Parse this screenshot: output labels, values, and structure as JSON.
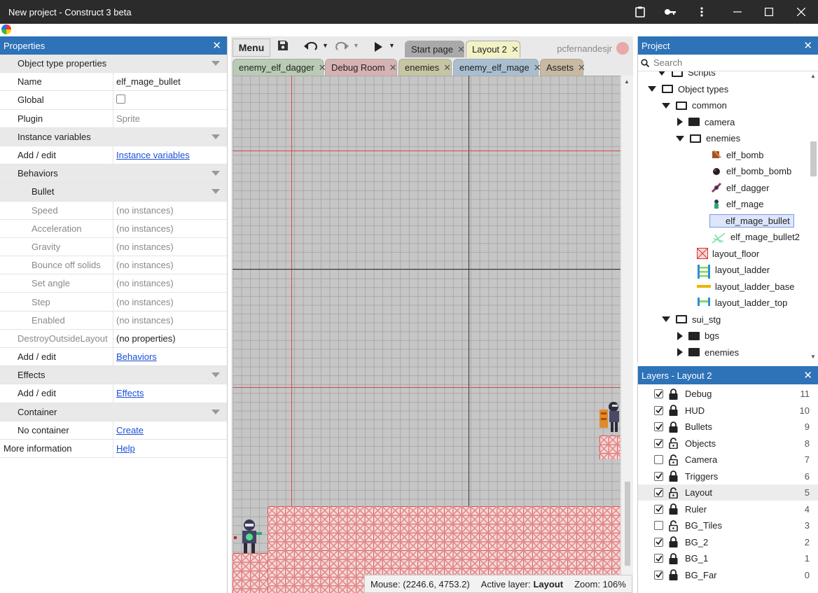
{
  "window": {
    "title": "New project - Construct 3 beta",
    "controls": [
      "clipboard-icon",
      "key-icon",
      "more-icon",
      "minimize-icon",
      "maximize-icon",
      "close-icon"
    ]
  },
  "properties": {
    "title": "Properties",
    "rows": [
      {
        "type": "section",
        "label": "Object type properties"
      },
      {
        "type": "row",
        "label": "Name",
        "value": "elf_mage_bullet"
      },
      {
        "type": "row",
        "label": "Global",
        "value": ""
      },
      {
        "type": "row",
        "label": "Plugin",
        "value": "Sprite",
        "dim": true
      },
      {
        "type": "section",
        "label": "Instance variables"
      },
      {
        "type": "row",
        "label": "Add / edit",
        "value": "Instance variables",
        "link": true
      },
      {
        "type": "section",
        "label": "Behaviors"
      },
      {
        "type": "subsection",
        "label": "Bullet"
      },
      {
        "type": "sub",
        "label": "Speed",
        "value": "(no instances)"
      },
      {
        "type": "sub",
        "label": "Acceleration",
        "value": "(no instances)"
      },
      {
        "type": "sub",
        "label": "Gravity",
        "value": "(no instances)"
      },
      {
        "type": "sub",
        "label": "Bounce off solids",
        "value": "(no instances)"
      },
      {
        "type": "sub",
        "label": "Set angle",
        "value": "(no instances)"
      },
      {
        "type": "sub",
        "label": "Step",
        "value": "(no instances)"
      },
      {
        "type": "sub",
        "label": "Enabled",
        "value": "(no instances)"
      },
      {
        "type": "rowgray",
        "label": "DestroyOutsideLayout",
        "value": "(no properties)"
      },
      {
        "type": "row",
        "label": "Add / edit",
        "value": "Behaviors",
        "link": true
      },
      {
        "type": "section",
        "label": "Effects"
      },
      {
        "type": "row",
        "label": "Add / edit",
        "value": "Effects",
        "link": true
      },
      {
        "type": "section",
        "label": "Container"
      },
      {
        "type": "row",
        "label": "No container",
        "value": "Create",
        "link": true
      },
      {
        "type": "lvl0",
        "label": "More information",
        "value": "Help",
        "link": true
      }
    ]
  },
  "editor": {
    "menu_label": "Menu",
    "tabs_row1": [
      {
        "label": "Start page",
        "color": "#a9a9a9"
      },
      {
        "label": "Layout 2",
        "color": "#f2f2c4"
      }
    ],
    "tabs_row2": [
      {
        "label": "enemy_elf_dagger",
        "color": "#b9cbb4"
      },
      {
        "label": "Debug Room",
        "color": "#d7b2b2"
      },
      {
        "label": "enemies",
        "color": "#c6c6a2"
      },
      {
        "label": "enemy_elf_mage",
        "color": "#a9bfd0"
      },
      {
        "label": "Assets",
        "color": "#c9b9a1"
      }
    ],
    "user": "pcfernandesjr",
    "status": {
      "mouse": "Mouse: (2246.6, 4753.2)",
      "layer_label": "Active layer:",
      "layer_value": "Layout",
      "zoom": "Zoom: 106%"
    }
  },
  "project": {
    "title": "Project",
    "search_placeholder": "Search",
    "tree": [
      {
        "label": "Scripts",
        "icon": "folder"
      },
      {
        "label": "Object types",
        "icon": "folder"
      },
      {
        "label": "common",
        "icon": "folder"
      },
      {
        "label": "camera",
        "icon": "folder-filled"
      },
      {
        "label": "enemies",
        "icon": "folder"
      },
      {
        "label": "elf_bomb",
        "icon": "sprite-bomb-icon"
      },
      {
        "label": "elf_bomb_bomb",
        "icon": "sprite-ball-icon"
      },
      {
        "label": "elf_dagger",
        "icon": "sprite-dagger-icon"
      },
      {
        "label": "elf_mage",
        "icon": "sprite-mage-icon"
      },
      {
        "label": "elf_mage_bullet",
        "icon": "sprite-bullet-icon",
        "selected": true
      },
      {
        "label": "elf_mage_bullet2",
        "icon": "sprite-bullet2-icon"
      },
      {
        "label": "layout_floor",
        "icon": "tile-floor-icon"
      },
      {
        "label": "layout_ladder",
        "icon": "tile-ladder-icon"
      },
      {
        "label": "layout_ladder_base",
        "icon": "tile-ladder-base-icon"
      },
      {
        "label": "layout_ladder_top",
        "icon": "tile-ladder-top-icon"
      },
      {
        "label": "sui_stg",
        "icon": "folder"
      },
      {
        "label": "bgs",
        "icon": "folder-filled"
      },
      {
        "label": "enemies",
        "icon": "folder-filled"
      }
    ]
  },
  "layers": {
    "title": "Layers - Layout 2",
    "items": [
      {
        "name": "Debug",
        "index": "11",
        "visible": true,
        "locked": true
      },
      {
        "name": "HUD",
        "index": "10",
        "visible": true,
        "locked": true
      },
      {
        "name": "Bullets",
        "index": "9",
        "visible": true,
        "locked": true
      },
      {
        "name": "Objects",
        "index": "8",
        "visible": true,
        "locked": false
      },
      {
        "name": "Camera",
        "index": "7",
        "visible": false,
        "locked": false
      },
      {
        "name": "Triggers",
        "index": "6",
        "visible": true,
        "locked": true
      },
      {
        "name": "Layout",
        "index": "5",
        "visible": true,
        "locked": false,
        "active": true
      },
      {
        "name": "Ruler",
        "index": "4",
        "visible": true,
        "locked": true
      },
      {
        "name": "BG_Tiles",
        "index": "3",
        "visible": false,
        "locked": false
      },
      {
        "name": "BG_2",
        "index": "2",
        "visible": true,
        "locked": true
      },
      {
        "name": "BG_1",
        "index": "1",
        "visible": true,
        "locked": true
      },
      {
        "name": "BG_Far",
        "index": "0",
        "visible": true,
        "locked": true
      }
    ]
  },
  "colors": {
    "panel_header": "#2e72b8",
    "titlebar": "#2b2b2b",
    "grid_line_red": "#d84a4a",
    "link": "#1a4fd8"
  }
}
